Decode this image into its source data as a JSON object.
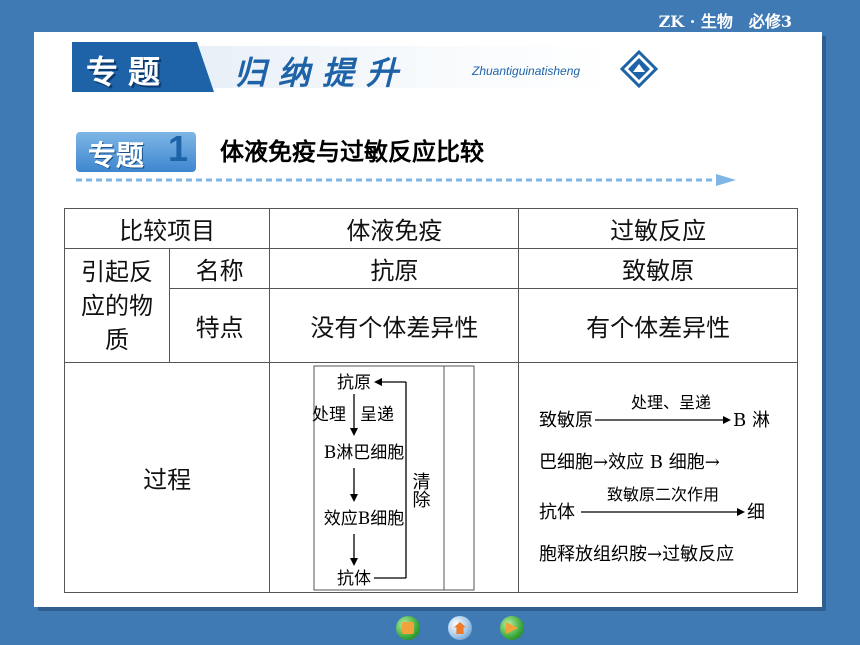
{
  "header": {
    "course": "ZK · 生物　必修3"
  },
  "banner": {
    "tab": "专题",
    "title": "归纳提升",
    "pinyin": "Zhuantiguinatisheng"
  },
  "section": {
    "tab": "专题",
    "number": "1",
    "title": "体液免疫与过敏反应比较"
  },
  "table": {
    "head": [
      "比较项目",
      "体液免疫",
      "过敏反应"
    ],
    "row_label": "引起反应的物质",
    "row_label_lines": [
      "引起反",
      "应的物",
      "质"
    ],
    "name_label": "名称",
    "name_values": [
      "抗原",
      "致敏原"
    ],
    "feature_label": "特点",
    "feature_values": [
      "没有个体差异性",
      "有个体差异性"
    ],
    "process_label": "过程",
    "humoral_flow": {
      "n1": "抗原",
      "e1a": "处理",
      "e1b": "呈递",
      "n2": "B淋巴细胞",
      "n3": "效应B细胞",
      "n4": "抗体",
      "clear": "清除"
    },
    "allergy_lines": {
      "l1_left": "致敏原",
      "l1_arrow": "处理、呈递",
      "l1_right": "B 淋",
      "l2": "巴细胞→效应 B 细胞→",
      "l3_left": "抗体",
      "l3_arrow": "致敏原二次作用",
      "l3_right": "细",
      "l4": "胞释放组织胺→过敏反应"
    }
  },
  "footer": {
    "icons": [
      "home-icon",
      "back-icon",
      "next-icon"
    ]
  }
}
